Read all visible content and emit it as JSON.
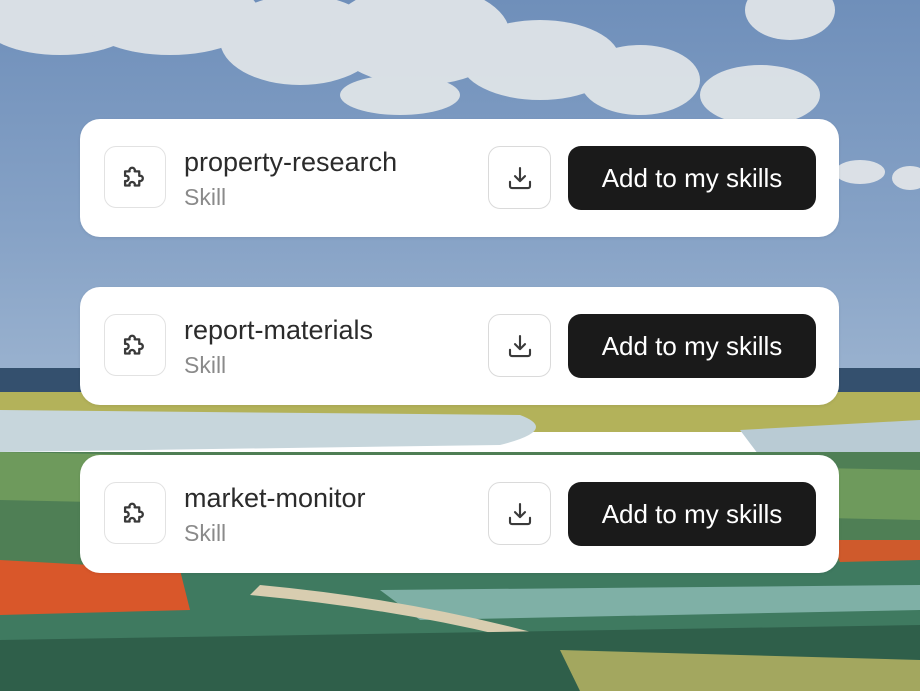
{
  "skills": [
    {
      "name": "property-research",
      "type": "Skill",
      "action_label": "Add to my skills"
    },
    {
      "name": "report-materials",
      "type": "Skill",
      "action_label": "Add to my skills"
    },
    {
      "name": "market-monitor",
      "type": "Skill",
      "action_label": "Add to my skills"
    }
  ],
  "icons": {
    "skill": "puzzle-icon",
    "download": "download-icon"
  },
  "colors": {
    "card_background": "#ffffff",
    "primary_button": "#1a1a1a",
    "primary_button_text": "#ffffff",
    "name_text": "#2b2b2b",
    "type_text": "#8a8a8a",
    "sky": "#7f9cc2",
    "sea": "#3b5a78",
    "field": "#5e8a55"
  }
}
